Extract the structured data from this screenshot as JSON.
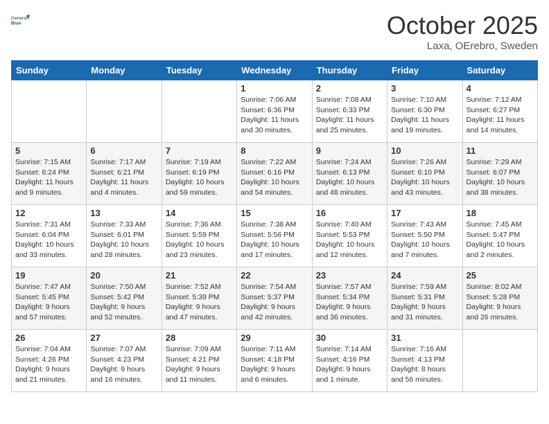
{
  "header": {
    "logo_general": "General",
    "logo_blue": "Blue",
    "month": "October 2025",
    "location": "Laxa, OErebro, Sweden"
  },
  "weekdays": [
    "Sunday",
    "Monday",
    "Tuesday",
    "Wednesday",
    "Thursday",
    "Friday",
    "Saturday"
  ],
  "weeks": [
    [
      {
        "day": "",
        "info": ""
      },
      {
        "day": "",
        "info": ""
      },
      {
        "day": "",
        "info": ""
      },
      {
        "day": "1",
        "info": "Sunrise: 7:06 AM\nSunset: 6:36 PM\nDaylight: 11 hours\nand 30 minutes."
      },
      {
        "day": "2",
        "info": "Sunrise: 7:08 AM\nSunset: 6:33 PM\nDaylight: 11 hours\nand 25 minutes."
      },
      {
        "day": "3",
        "info": "Sunrise: 7:10 AM\nSunset: 6:30 PM\nDaylight: 11 hours\nand 19 minutes."
      },
      {
        "day": "4",
        "info": "Sunrise: 7:12 AM\nSunset: 6:27 PM\nDaylight: 11 hours\nand 14 minutes."
      }
    ],
    [
      {
        "day": "5",
        "info": "Sunrise: 7:15 AM\nSunset: 6:24 PM\nDaylight: 11 hours\nand 9 minutes."
      },
      {
        "day": "6",
        "info": "Sunrise: 7:17 AM\nSunset: 6:21 PM\nDaylight: 11 hours\nand 4 minutes."
      },
      {
        "day": "7",
        "info": "Sunrise: 7:19 AM\nSunset: 6:19 PM\nDaylight: 10 hours\nand 59 minutes."
      },
      {
        "day": "8",
        "info": "Sunrise: 7:22 AM\nSunset: 6:16 PM\nDaylight: 10 hours\nand 54 minutes."
      },
      {
        "day": "9",
        "info": "Sunrise: 7:24 AM\nSunset: 6:13 PM\nDaylight: 10 hours\nand 48 minutes."
      },
      {
        "day": "10",
        "info": "Sunrise: 7:26 AM\nSunset: 6:10 PM\nDaylight: 10 hours\nand 43 minutes."
      },
      {
        "day": "11",
        "info": "Sunrise: 7:29 AM\nSunset: 6:07 PM\nDaylight: 10 hours\nand 38 minutes."
      }
    ],
    [
      {
        "day": "12",
        "info": "Sunrise: 7:31 AM\nSunset: 6:04 PM\nDaylight: 10 hours\nand 33 minutes."
      },
      {
        "day": "13",
        "info": "Sunrise: 7:33 AM\nSunset: 6:01 PM\nDaylight: 10 hours\nand 28 minutes."
      },
      {
        "day": "14",
        "info": "Sunrise: 7:36 AM\nSunset: 5:59 PM\nDaylight: 10 hours\nand 23 minutes."
      },
      {
        "day": "15",
        "info": "Sunrise: 7:38 AM\nSunset: 5:56 PM\nDaylight: 10 hours\nand 17 minutes."
      },
      {
        "day": "16",
        "info": "Sunrise: 7:40 AM\nSunset: 5:53 PM\nDaylight: 10 hours\nand 12 minutes."
      },
      {
        "day": "17",
        "info": "Sunrise: 7:43 AM\nSunset: 5:50 PM\nDaylight: 10 hours\nand 7 minutes."
      },
      {
        "day": "18",
        "info": "Sunrise: 7:45 AM\nSunset: 5:47 PM\nDaylight: 10 hours\nand 2 minutes."
      }
    ],
    [
      {
        "day": "19",
        "info": "Sunrise: 7:47 AM\nSunset: 5:45 PM\nDaylight: 9 hours\nand 57 minutes."
      },
      {
        "day": "20",
        "info": "Sunrise: 7:50 AM\nSunset: 5:42 PM\nDaylight: 9 hours\nand 52 minutes."
      },
      {
        "day": "21",
        "info": "Sunrise: 7:52 AM\nSunset: 5:39 PM\nDaylight: 9 hours\nand 47 minutes."
      },
      {
        "day": "22",
        "info": "Sunrise: 7:54 AM\nSunset: 5:37 PM\nDaylight: 9 hours\nand 42 minutes."
      },
      {
        "day": "23",
        "info": "Sunrise: 7:57 AM\nSunset: 5:34 PM\nDaylight: 9 hours\nand 36 minutes."
      },
      {
        "day": "24",
        "info": "Sunrise: 7:59 AM\nSunset: 5:31 PM\nDaylight: 9 hours\nand 31 minutes."
      },
      {
        "day": "25",
        "info": "Sunrise: 8:02 AM\nSunset: 5:28 PM\nDaylight: 9 hours\nand 26 minutes."
      }
    ],
    [
      {
        "day": "26",
        "info": "Sunrise: 7:04 AM\nSunset: 4:26 PM\nDaylight: 9 hours\nand 21 minutes."
      },
      {
        "day": "27",
        "info": "Sunrise: 7:07 AM\nSunset: 4:23 PM\nDaylight: 9 hours\nand 16 minutes."
      },
      {
        "day": "28",
        "info": "Sunrise: 7:09 AM\nSunset: 4:21 PM\nDaylight: 9 hours\nand 11 minutes."
      },
      {
        "day": "29",
        "info": "Sunrise: 7:11 AM\nSunset: 4:18 PM\nDaylight: 9 hours\nand 6 minutes."
      },
      {
        "day": "30",
        "info": "Sunrise: 7:14 AM\nSunset: 4:16 PM\nDaylight: 9 hours\nand 1 minute."
      },
      {
        "day": "31",
        "info": "Sunrise: 7:16 AM\nSunset: 4:13 PM\nDaylight: 8 hours\nand 56 minutes."
      },
      {
        "day": "",
        "info": ""
      }
    ]
  ]
}
